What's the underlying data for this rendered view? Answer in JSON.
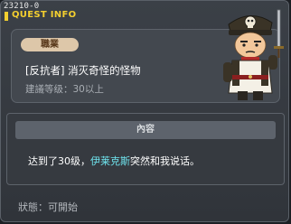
{
  "quest": {
    "id": "23210-0",
    "window_title": "QUEST INFO",
    "job_label": "職業",
    "job_name": "[反抗者] 消灭奇怪的怪物",
    "recommended_level": "建議等级：30以上",
    "content_header": "內容",
    "content_prefix": "达到了30级，",
    "content_npc": "伊莱克斯",
    "content_suffix": "突然和我说话。",
    "status": "狀態：可開始"
  },
  "colors": {
    "title_yellow": "#f3cf2f",
    "npc_highlight": "#6fe4ee",
    "job_pill": "#ddc7a9"
  },
  "icons": {
    "npc_portrait": "military-officer-npc-icon"
  }
}
